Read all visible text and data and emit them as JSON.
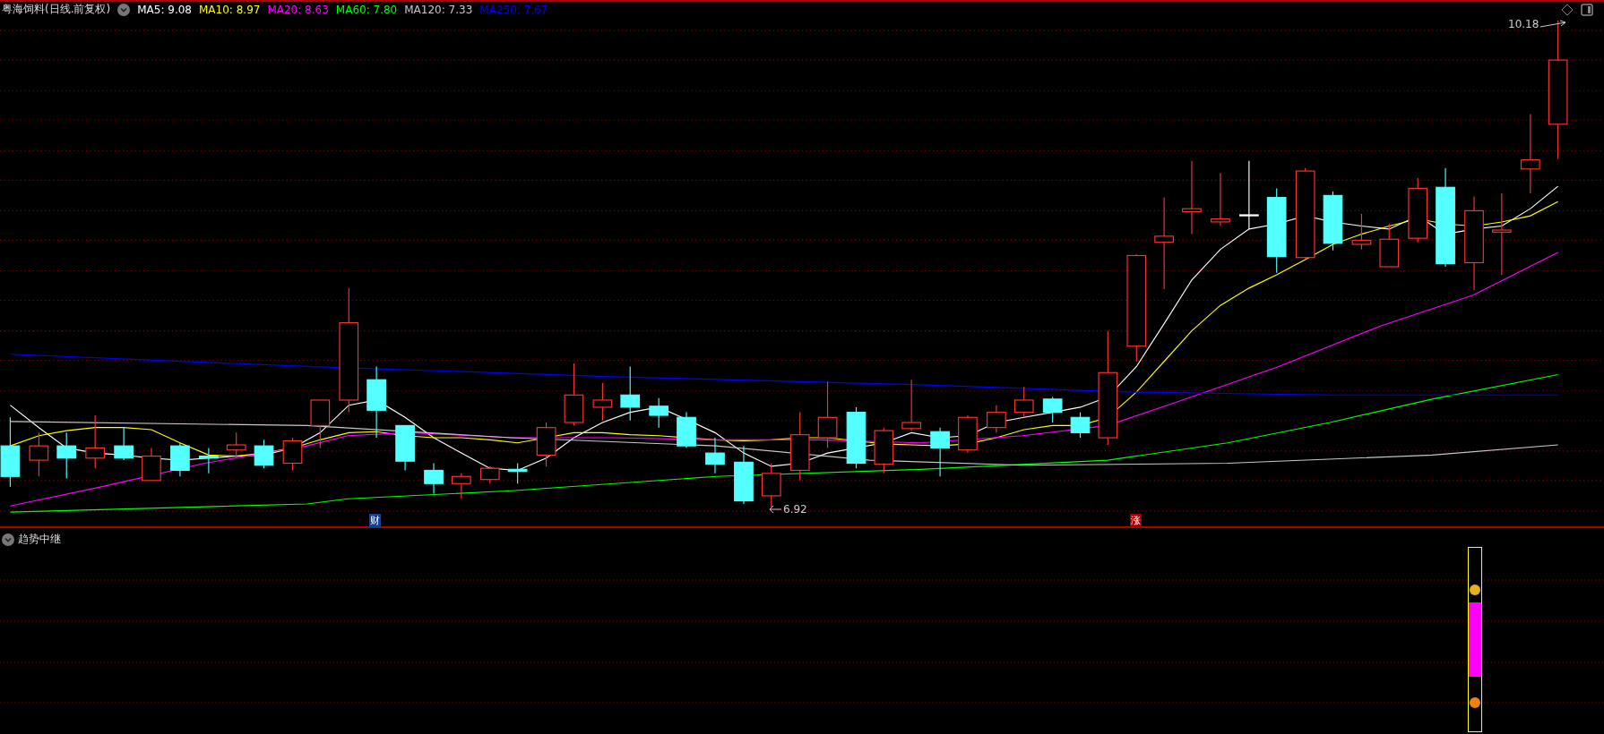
{
  "chart_header": {
    "title": "粤海饲料(日线.前复权)",
    "moving_averages": [
      {
        "label": "MA5:",
        "value": "9.08",
        "color": "#ffffff"
      },
      {
        "label": "MA10:",
        "value": "8.97",
        "color": "#ffff00"
      },
      {
        "label": "MA20:",
        "value": "8.63",
        "color": "#ff00ff"
      },
      {
        "label": "MA60:",
        "value": "7.80",
        "color": "#00ff00"
      },
      {
        "label": "MA120:",
        "value": "7.33",
        "color": "#c8c8c8"
      },
      {
        "label": "MA250:",
        "value": "7.67",
        "color": "#0000ff"
      }
    ]
  },
  "price_labels": [
    {
      "kind": "high",
      "text": "10.18"
    },
    {
      "kind": "low",
      "text": "6.92"
    }
  ],
  "event_markers": [
    {
      "text": "财",
      "color": "#1c3d8c"
    },
    {
      "text": "涨",
      "color": "#a00000"
    }
  ],
  "indicator_panel": {
    "title": "趋势中继"
  }
}
